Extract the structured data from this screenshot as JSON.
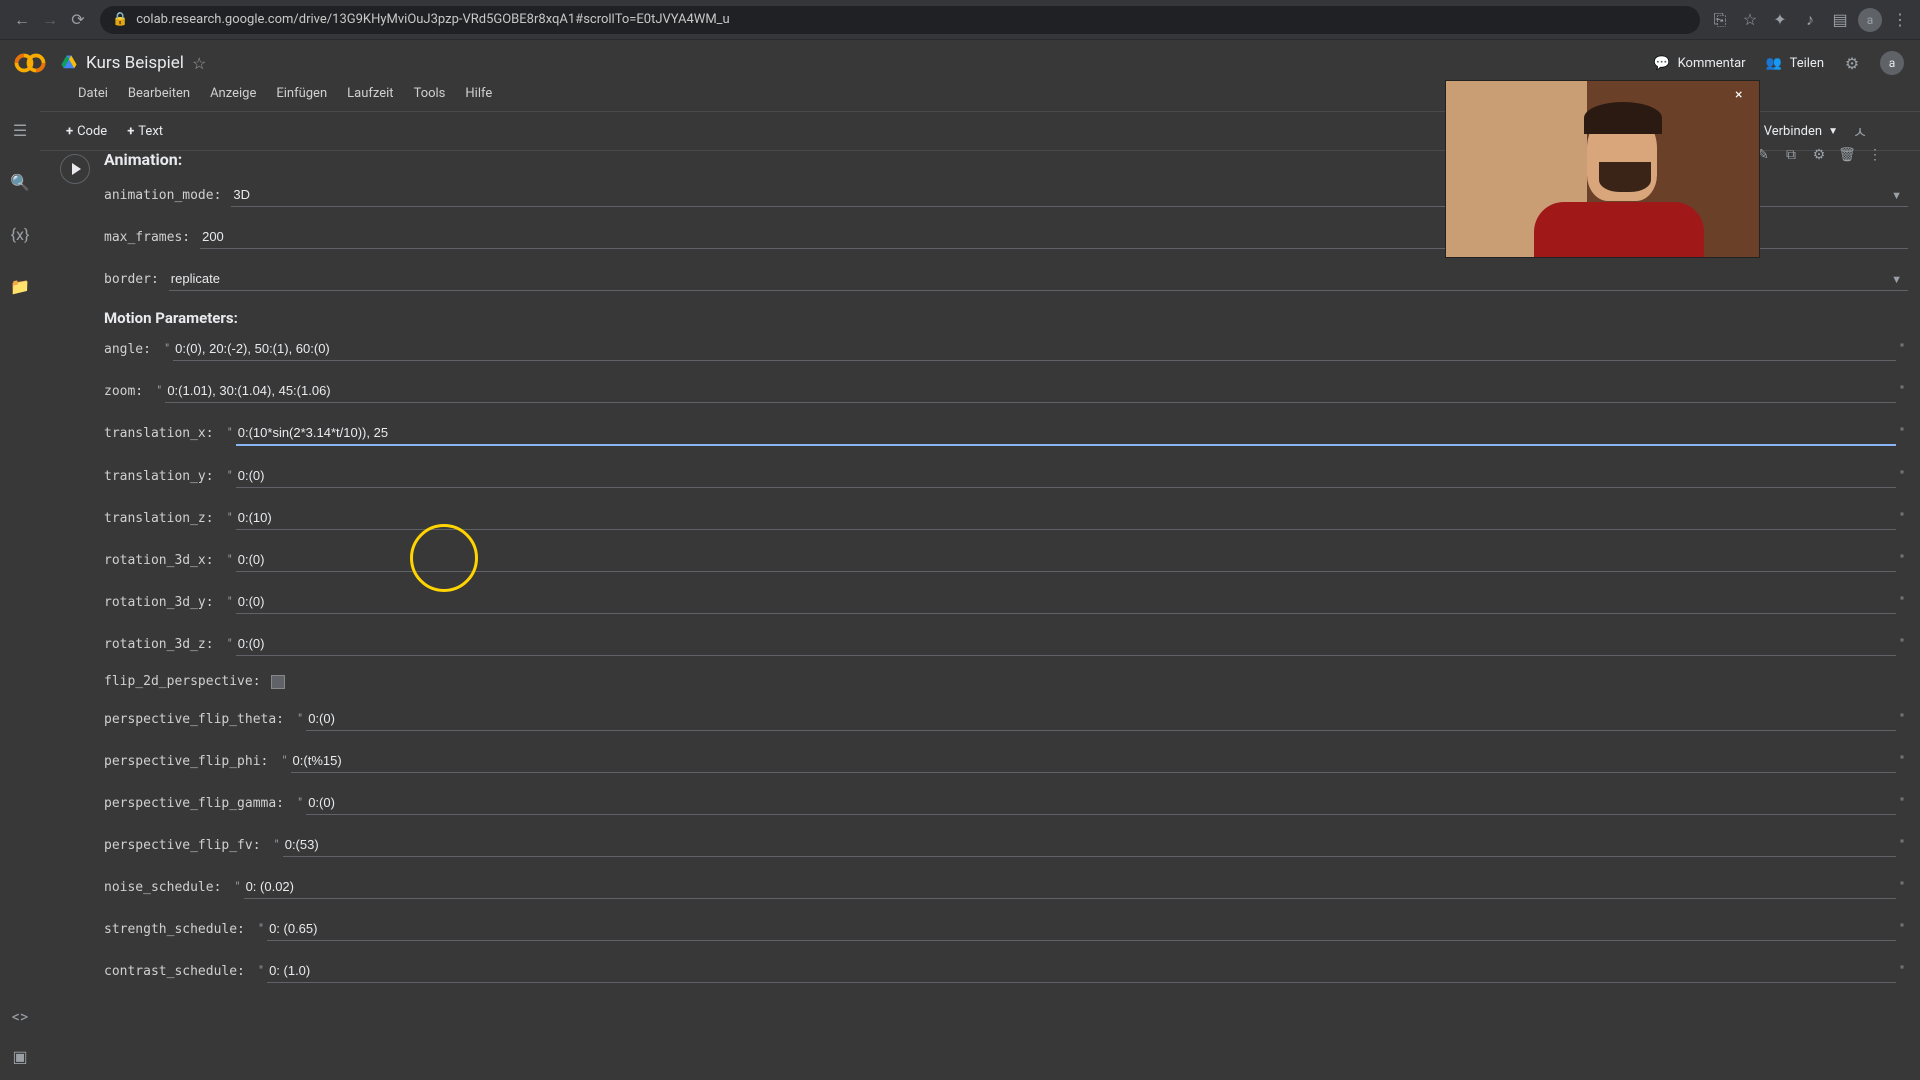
{
  "browser": {
    "url": "colab.research.google.com/drive/13G9KHyMviOuJ3pzp-VRd5GOBE8r8xqA1#scrollTo=E0tJVYA4WM_u"
  },
  "header": {
    "doc_title": "Kurs Beispiel",
    "comment": "Kommentar",
    "share": "Teilen",
    "avatar_letter": "a"
  },
  "menu": {
    "file": "Datei",
    "edit": "Bearbeiten",
    "view": "Anzeige",
    "insert": "Einfügen",
    "runtime": "Laufzeit",
    "tools": "Tools",
    "help": "Hilfe"
  },
  "toolbar": {
    "code": "Code",
    "text": "Text",
    "connect": "Verbinden"
  },
  "cell": {
    "section_animation": "Animation:",
    "section_motion": "Motion Parameters:",
    "labels": {
      "animation_mode": "animation_mode:",
      "max_frames": "max_frames:",
      "border": "border:",
      "angle": "angle:",
      "zoom": "zoom:",
      "translation_x": "translation_x:",
      "translation_y": "translation_y:",
      "translation_z": "translation_z:",
      "rotation_3d_x": "rotation_3d_x:",
      "rotation_3d_y": "rotation_3d_y:",
      "rotation_3d_z": "rotation_3d_z:",
      "flip_2d_perspective": "flip_2d_perspective:",
      "perspective_flip_theta": "perspective_flip_theta:",
      "perspective_flip_phi": "perspective_flip_phi:",
      "perspective_flip_gamma": "perspective_flip_gamma:",
      "perspective_flip_fv": "perspective_flip_fv:",
      "noise_schedule": "noise_schedule:",
      "strength_schedule": "strength_schedule:",
      "contrast_schedule": "contrast_schedule:"
    },
    "values": {
      "animation_mode": "3D",
      "max_frames": "200",
      "border": "replicate",
      "angle": "0:(0), 20:(-2), 50:(1), 60:(0)",
      "zoom": "0:(1.01), 30:(1.04), 45:(1.06)",
      "translation_x": "0:(10*sin(2*3.14*t/10)), 25",
      "translation_y": "0:(0)",
      "translation_z": "0:(10)",
      "rotation_3d_x": "0:(0)",
      "rotation_3d_y": "0:(0)",
      "rotation_3d_z": "0:(0)",
      "perspective_flip_theta": "0:(0)",
      "perspective_flip_phi": "0:(t%15)",
      "perspective_flip_gamma": "0:(0)",
      "perspective_flip_fv": "0:(53)",
      "noise_schedule": "0: (0.02)",
      "strength_schedule": "0: (0.65)",
      "contrast_schedule": "0: (1.0)"
    }
  }
}
